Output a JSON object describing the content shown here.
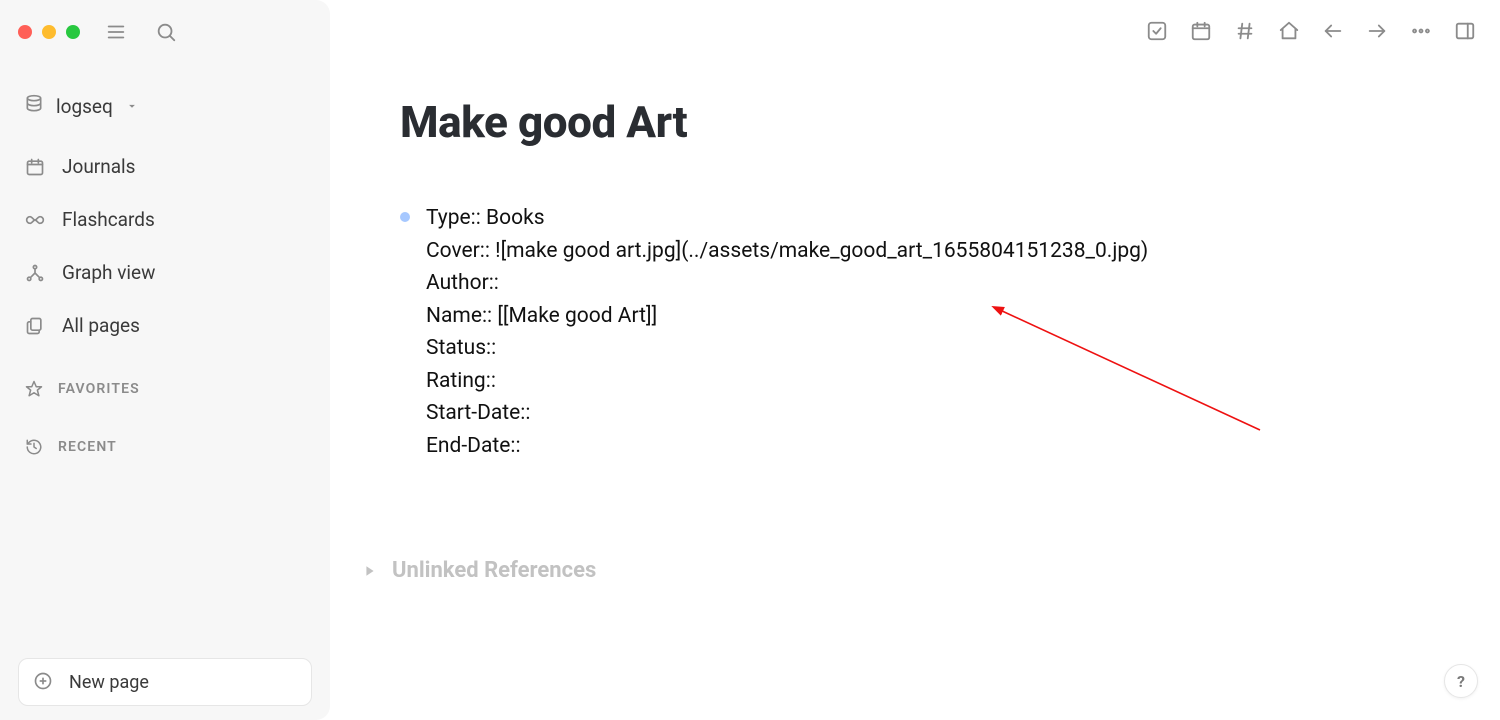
{
  "sidebar": {
    "graph_name": "logseq",
    "nav": {
      "journals": "Journals",
      "flashcards": "Flashcards",
      "graph_view": "Graph view",
      "all_pages": "All pages"
    },
    "favorites_label": "FAVORITES",
    "recent_label": "RECENT",
    "new_page_label": "New page"
  },
  "page": {
    "title": "Make good Art",
    "properties": [
      "Type:: Books",
      "Cover:: ![make good art.jpg](../assets/make_good_art_1655804151238_0.jpg)",
      "Author::",
      "Name:: [[Make good Art]]",
      "Status::",
      "Rating::",
      "Start-Date::",
      "End-Date::"
    ],
    "unlinked_label": "Unlinked References"
  },
  "help": "?"
}
